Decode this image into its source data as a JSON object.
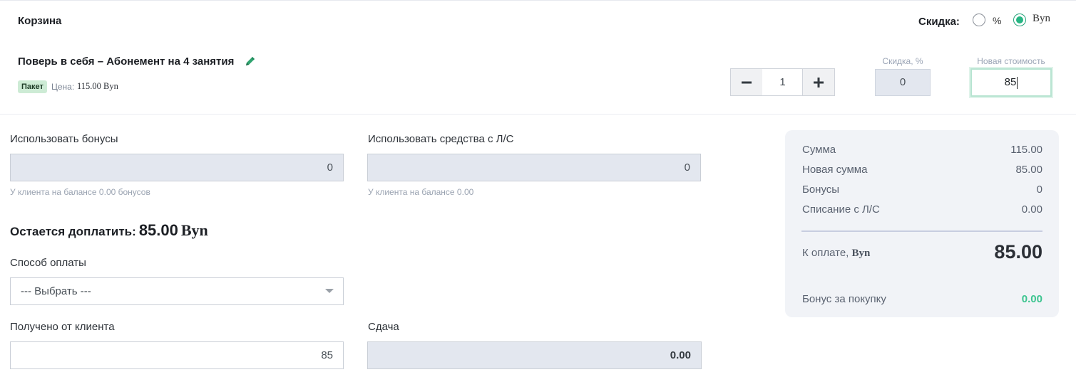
{
  "cart": {
    "title": "Корзина"
  },
  "discount": {
    "label": "Скидка:",
    "options": [
      "%",
      "Byn"
    ],
    "selected": "Byn"
  },
  "item": {
    "name": "Поверь в себя – Абонемент на 4 занятия",
    "badge": "Пакет",
    "price_label": "Цена:",
    "price_value": "115.00 Byn",
    "quantity": "1",
    "discount_pct_label": "Скидка, %",
    "discount_pct_value": "0",
    "new_price_label": "Новая стоимость",
    "new_price_value": "85",
    "icons": {
      "edit": "pencil-icon",
      "minus": "minus-icon",
      "plus": "plus-icon"
    }
  },
  "payment": {
    "bonus_label": "Использовать бонусы",
    "bonus_value": "0",
    "bonus_hint": "У клиента на балансе 0.00 бонусов",
    "ls_label": "Использовать средства с Л/С",
    "ls_value": "0",
    "ls_hint": "У клиента на балансе 0.00",
    "remaining_label": "Остается доплатить:",
    "remaining_amount": "85.00",
    "remaining_currency": "Byn",
    "method_label": "Способ оплаты",
    "method_value": "--- Выбрать ---",
    "received_label": "Получено от клиента",
    "received_value": "85",
    "change_label": "Сдача",
    "change_value": "0.00"
  },
  "summary": {
    "rows": [
      {
        "label": "Сумма",
        "value": "115.00"
      },
      {
        "label": "Новая сумма",
        "value": "85.00"
      },
      {
        "label": "Бонусы",
        "value": "0"
      },
      {
        "label": "Списание с Л/С",
        "value": "0.00"
      }
    ],
    "to_pay_label": "К оплате,",
    "to_pay_currency": "Byn",
    "to_pay_value": "85.00",
    "bonus_label": "Бонус за покупку",
    "bonus_value": "0.00"
  },
  "colors": {
    "accent": "#27b583",
    "input_readonly": "#e3e7ef",
    "summary_bg": "#f1f3f7",
    "badge_bg": "#cdebd5"
  }
}
